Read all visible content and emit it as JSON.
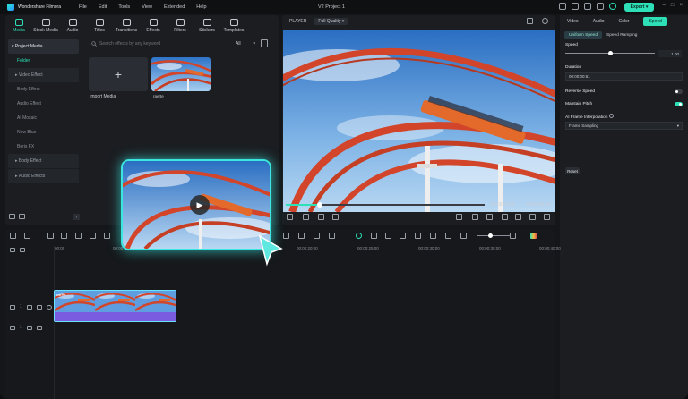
{
  "app": {
    "name": "Wondershare Filmora",
    "project_title": "V2 Project 1",
    "export_label": "Export"
  },
  "menu": [
    "File",
    "Edit",
    "Tools",
    "View",
    "Extended",
    "Help"
  ],
  "media_tabs": [
    {
      "label": "Media",
      "icon": "media-icon",
      "active": true
    },
    {
      "label": "Stock Media",
      "icon": "stock-media-icon"
    },
    {
      "label": "Audio",
      "icon": "audio-icon"
    },
    {
      "label": "Titles",
      "icon": "titles-icon"
    },
    {
      "label": "Transitions",
      "icon": "transitions-icon"
    },
    {
      "label": "Effects",
      "icon": "effects-icon"
    },
    {
      "label": "Filters",
      "icon": "filters-icon"
    },
    {
      "label": "Stickers",
      "icon": "stickers-icon"
    },
    {
      "label": "Templates",
      "icon": "templates-icon"
    }
  ],
  "sidebar": {
    "project_media": "Project Media",
    "folder": "Folder",
    "video_effect": "Video Effect",
    "items": [
      "Body Effect",
      "Audio Effect",
      "AI Mosaic",
      "New Blue",
      "Boris FX"
    ],
    "body_effect": "Body Effect",
    "audio_effects": "Audio Effects"
  },
  "search": {
    "placeholder": "Search effects by any keyword",
    "filter_value": "All"
  },
  "media": {
    "import_label": "Import Media",
    "clip_name": "raerte"
  },
  "player": {
    "label": "PLAYER",
    "quality": "Full Quality",
    "current_time": "00:00:00:00",
    "total_time": "00:00:00:00",
    "separator": "/"
  },
  "right_panel": {
    "tabs": [
      "Video",
      "Audio",
      "Color",
      "Speed"
    ],
    "active_tab": "Speed",
    "subtabs": [
      "Uniform Speed",
      "Speed Ramping"
    ],
    "speed_label": "Speed",
    "speed_value": "1.00",
    "duration_label": "Duration",
    "duration_value": "00:00:00:61",
    "reverse_label": "Reverse Speed",
    "reverse_on": false,
    "pitch_label": "Maintain Pitch",
    "pitch_on": true,
    "interp_label": "AI Frame Interpolation",
    "interp_value": "Frame Sampling",
    "reset_label": "Reset"
  },
  "timeline": {
    "ruler": [
      "00:00",
      "00:00:05:00",
      "00:00:10:00",
      "00:00:15:00",
      "00:00:20:00",
      "00:00:25:00",
      "00:00:30:00",
      "00:00:35:00",
      "00:00:40:00",
      "00:00:45:00",
      "00:00:50:00"
    ],
    "video_track": "1",
    "audio_track": "1",
    "clip_label": "raerte"
  },
  "colors": {
    "accent": "#2de0b8",
    "glow": "#3ce6e0",
    "clip": "#6d5bd8"
  }
}
